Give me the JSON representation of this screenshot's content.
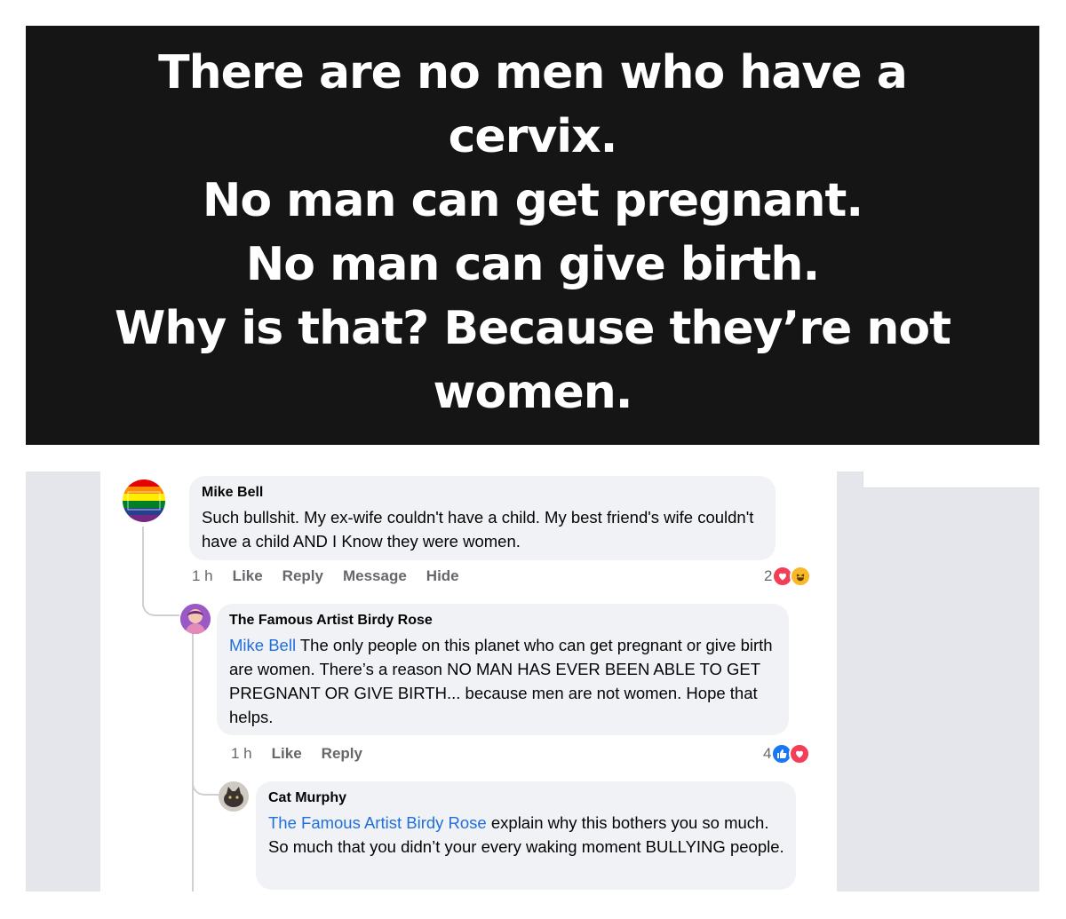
{
  "quote": {
    "text": "There are no men who have a\ncervix.\nNo man can get pregnant.\nNo man can give birth.\nWhy is that? Because they’re not\nwomen."
  },
  "comments": [
    {
      "author": "Mike Bell",
      "text": "Such bullshit. My ex-wife couldn't have a child. My best friend's wife couldn't have a child AND I Know they were women.",
      "actions": {
        "time": "1 h",
        "like": "Like",
        "reply": "Reply",
        "message": "Message",
        "hide": "Hide"
      },
      "reaction_count": "2",
      "reaction_icons": [
        "love-icon",
        "haha-icon"
      ]
    },
    {
      "author": "The Famous Artist Birdy Rose",
      "mention": "Mike Bell",
      "text": " The only people on this planet who can get pregnant or give birth are women. There’s a reason NO MAN HAS EVER BEEN ABLE TO GET PREGNANT OR GIVE BIRTH... because men are not women. Hope that helps.",
      "actions": {
        "time": "1 h",
        "like": "Like",
        "reply": "Reply"
      },
      "reaction_count": "4",
      "reaction_icons": [
        "like-icon",
        "love-icon"
      ]
    },
    {
      "author": "Cat Murphy",
      "mention": "The Famous Artist Birdy Rose",
      "text": " explain why this bothers you so much. So much that you didn’t your every waking moment BULLYING people."
    }
  ],
  "colors": {
    "mention": "#216fdb",
    "love": "#f33e58",
    "like": "#1877f2",
    "haha": "#f7b928"
  }
}
